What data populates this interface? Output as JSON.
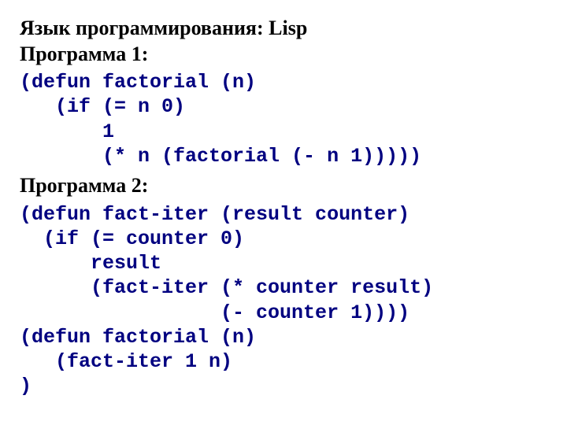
{
  "headings": {
    "lang": "Язык программирования: Lisp",
    "prog1": "Программа 1:",
    "prog2": "Программа 2:"
  },
  "code": {
    "prog1": "(defun factorial (n)\n   (if (= n 0)\n       1\n       (* n (factorial (- n 1)))))",
    "prog2": "(defun fact-iter (result counter)\n  (if (= counter 0)\n      result\n      (fact-iter (* counter result)\n                 (- counter 1))))\n(defun factorial (n)\n   (fact-iter 1 n)\n)"
  }
}
